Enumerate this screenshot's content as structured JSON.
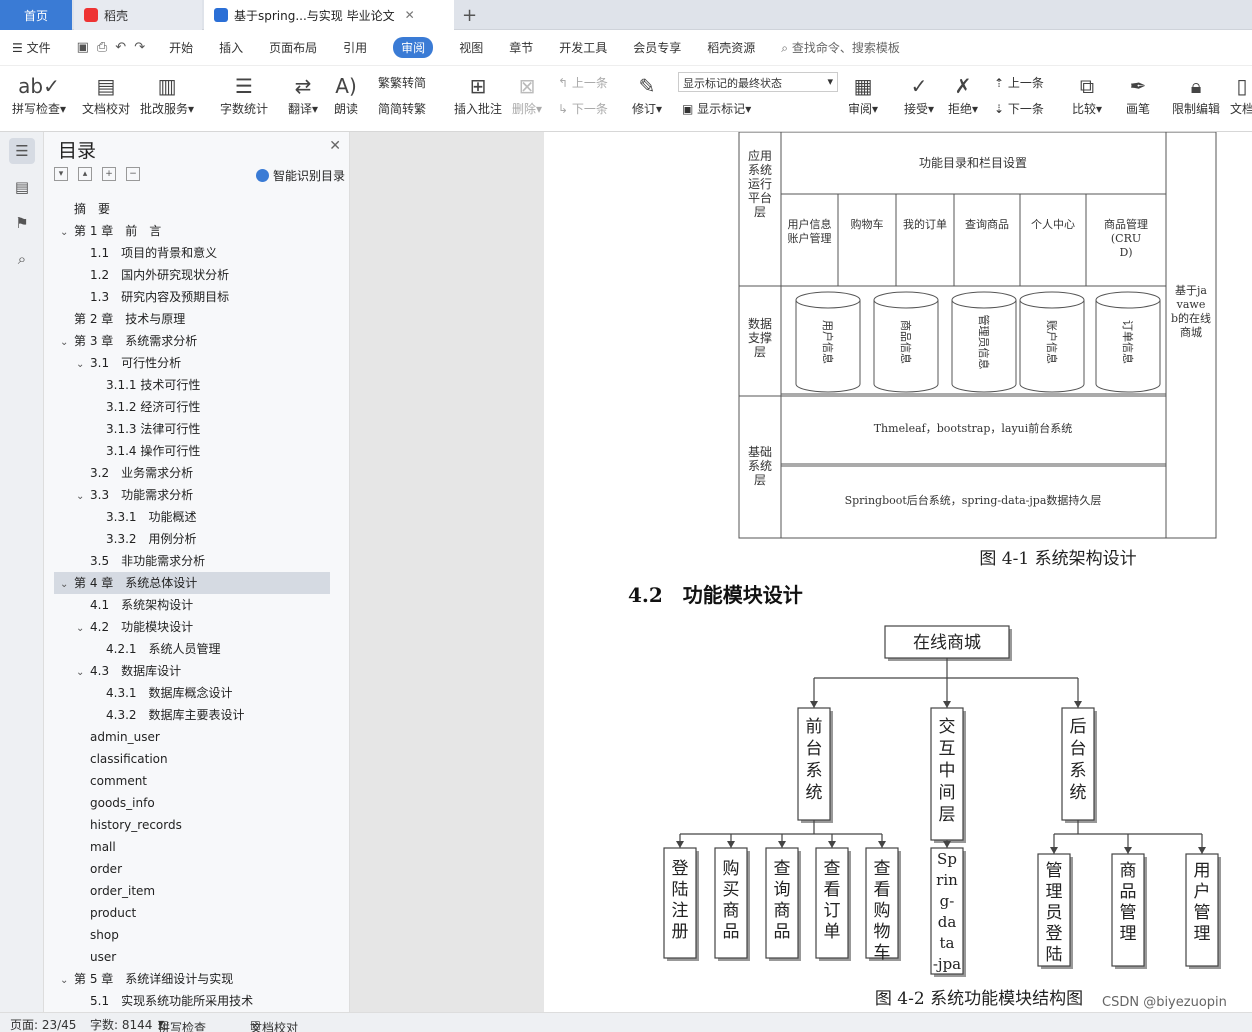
{
  "tabs": [
    {
      "label": "首页"
    },
    {
      "label": "稻壳"
    },
    {
      "label": "基于spring...与实现 毕业论文"
    }
  ],
  "menu": {
    "file": "文件",
    "items": [
      "开始",
      "插入",
      "页面布局",
      "引用",
      "审阅",
      "视图",
      "章节",
      "开发工具",
      "会员专享",
      "稻壳资源"
    ],
    "active": "审阅",
    "search": "查找命令、搜索模板"
  },
  "toolbar": {
    "spell": "拼写检查",
    "doccheck": "文档校对",
    "batch": "批改服务",
    "wordcount": "字数统计",
    "translate": "翻译",
    "read": "朗读",
    "trad": "繁转简",
    "simp": "简转繁",
    "insert_comment": "插入批注",
    "delete": "删除",
    "prev": "上一条",
    "next": "下一条",
    "revise": "修订",
    "markup_select": "显示标记的最终状态",
    "show_markup": "显示标记",
    "review": "审阅",
    "accept": "接受",
    "reject": "拒绝",
    "prev2": "上一条",
    "next2": "下一条",
    "compare": "比较",
    "pen": "画笔",
    "restrict": "限制编辑",
    "docx": "文档"
  },
  "toc": {
    "title": "目录",
    "ai": "智能识别目录",
    "items": [
      {
        "label": "摘　要",
        "level": 1,
        "chev": ""
      },
      {
        "label": "第 1 章　前　言",
        "level": 1,
        "chev": "v"
      },
      {
        "label": "1.1　项目的背景和意义",
        "level": 2,
        "chev": ""
      },
      {
        "label": "1.2　国内外研究现状分析",
        "level": 2,
        "chev": ""
      },
      {
        "label": "1.3　研究内容及预期目标",
        "level": 2,
        "chev": ""
      },
      {
        "label": "第 2 章　技术与原理",
        "level": 1,
        "chev": ""
      },
      {
        "label": "第 3 章　系统需求分析",
        "level": 1,
        "chev": "v"
      },
      {
        "label": "3.1　可行性分析",
        "level": 2,
        "chev": "v"
      },
      {
        "label": "3.1.1 技术可行性",
        "level": 3,
        "chev": ""
      },
      {
        "label": "3.1.2 经济可行性",
        "level": 3,
        "chev": ""
      },
      {
        "label": "3.1.3 法律可行性",
        "level": 3,
        "chev": ""
      },
      {
        "label": "3.1.4 操作可行性",
        "level": 3,
        "chev": ""
      },
      {
        "label": "3.2　业务需求分析",
        "level": 2,
        "chev": ""
      },
      {
        "label": "3.3　功能需求分析",
        "level": 2,
        "chev": "v"
      },
      {
        "label": "3.3.1　功能概述",
        "level": 3,
        "chev": ""
      },
      {
        "label": "3.3.2　用例分析",
        "level": 3,
        "chev": ""
      },
      {
        "label": "3.5　非功能需求分析",
        "level": 2,
        "chev": ""
      },
      {
        "label": "第 4 章　系统总体设计",
        "level": 1,
        "chev": "v",
        "selected": true
      },
      {
        "label": "4.1　系统架构设计",
        "level": 2,
        "chev": ""
      },
      {
        "label": "4.2　功能模块设计",
        "level": 2,
        "chev": "v"
      },
      {
        "label": "4.2.1　系统人员管理",
        "level": 3,
        "chev": ""
      },
      {
        "label": "4.3　数据库设计",
        "level": 2,
        "chev": "v"
      },
      {
        "label": "4.3.1　数据库概念设计",
        "level": 3,
        "chev": ""
      },
      {
        "label": "4.3.2　数据库主要表设计",
        "level": 3,
        "chev": ""
      },
      {
        "label": "admin_user",
        "level": 2,
        "chev": ""
      },
      {
        "label": "classification",
        "level": 2,
        "chev": ""
      },
      {
        "label": "comment",
        "level": 2,
        "chev": ""
      },
      {
        "label": "goods_info",
        "level": 2,
        "chev": ""
      },
      {
        "label": "history_records",
        "level": 2,
        "chev": ""
      },
      {
        "label": "mall",
        "level": 2,
        "chev": ""
      },
      {
        "label": "order",
        "level": 2,
        "chev": ""
      },
      {
        "label": "order_item",
        "level": 2,
        "chev": ""
      },
      {
        "label": "product",
        "level": 2,
        "chev": ""
      },
      {
        "label": "shop",
        "level": 2,
        "chev": ""
      },
      {
        "label": "user",
        "level": 2,
        "chev": ""
      },
      {
        "label": "第 5 章　系统详细设计与实现",
        "level": 1,
        "chev": "v"
      },
      {
        "label": "5.1　实现系统功能所采用技术",
        "level": 2,
        "chev": ""
      }
    ]
  },
  "doc": {
    "arch": {
      "layer_app": "应用系统运行平台层",
      "layer_data": "数据支撑层",
      "layer_base": "基础系统层",
      "side": "基于javaweb的在线商城",
      "top_box": "功能目录和栏目设置",
      "modules": [
        "用户信息账户管理",
        "购物车",
        "我的订单",
        "查询商品",
        "个人中心",
        "商品管理(CRUD)"
      ],
      "dbs": [
        "用户信息",
        "商品信息",
        "管理员信息",
        "账户信息",
        "订单信息"
      ],
      "front": "Thmeleaf，bootstrap，layui前台系统",
      "back": "Springboot后台系统，spring-data-jpa数据持久层",
      "caption": "图 4-1 系统架构设计"
    },
    "section": "4.2　功能模块设计",
    "func": {
      "root": "在线商城",
      "mid": [
        "前台系统",
        "交互中间层",
        "后台系统"
      ],
      "front_leaves": [
        "登陆注册",
        "购买商品",
        "查询商品",
        "查看订单",
        "查看购物车"
      ],
      "middle_leaf": "Spring-data-jpa",
      "back_leaves": [
        "管理员登陆",
        "商品管理",
        "用户管理"
      ],
      "caption": "图 4-2 系统功能模块结构图"
    }
  },
  "status": {
    "page": "页面: 23/45",
    "words": "字数: 8144",
    "spell": "拼写检查",
    "check": "文档校对",
    "watermark": "CSDN @biyezuopin"
  }
}
